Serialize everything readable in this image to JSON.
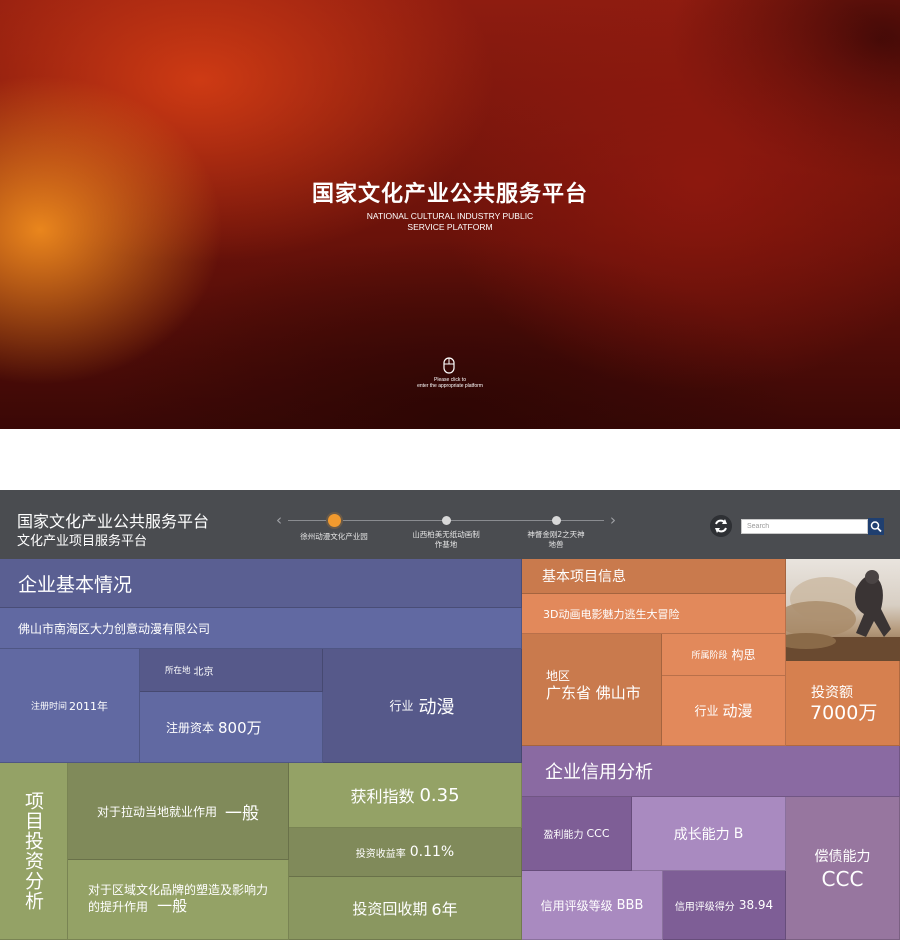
{
  "hero": {
    "title": "国家文化产业公共服务平台",
    "subtitle_line1": "NATIONAL CULTURAL INDUSTRY PUBLIC",
    "subtitle_line2": "SERVICE PLATFORM",
    "hint_line1": "Please click to",
    "hint_line2": "enter the appropriate platform",
    "mouse_icon": "mouse-icon"
  },
  "header": {
    "title": "国家文化产业公共服务平台",
    "subtitle": "文化产业项目服务平台",
    "timeline": [
      {
        "label": "徐州动漫文化产业园",
        "active": true
      },
      {
        "label_line1": "山西柏美无纸动画制",
        "label_line2": "作基地",
        "active": false
      },
      {
        "label_line1": "神督金刚2之天神",
        "label_line2": "地兽",
        "active": false
      }
    ],
    "search": {
      "placeholder": "Search"
    },
    "icons": {
      "refresh": "refresh-icon",
      "search": "search-icon",
      "prev": "chevron-left-icon",
      "next": "chevron-right-icon"
    }
  },
  "company": {
    "heading": "企业基本情况",
    "name": "佛山市南海区大力创意动漫有限公司",
    "reg_time_label": "注册时间",
    "reg_time_value": "2011年",
    "location_label": "所在地",
    "location_value": "北京",
    "capital_label": "注册资本",
    "capital_value": "800万",
    "industry_label": "行业",
    "industry_value": "动漫"
  },
  "project_info": {
    "heading": "基本项目信息",
    "project_name": "3D动画电影魅力逃生大冒险",
    "region_label": "地区",
    "region_value": "广东省 佛山市",
    "stage_label": "所属阶段",
    "stage_value": "构思",
    "industry_label": "行业",
    "industry_value": "动漫",
    "investment_label": "投资额",
    "investment_value": "7000万"
  },
  "investment": {
    "heading": "项目投资分析",
    "employment_label": "对于拉动当地就业作用",
    "employment_value": "一般",
    "brand_label_line1": "对于区域文化品牌的塑造及影响力",
    "brand_label_line2": "的提升作用",
    "brand_value": "一般",
    "profit_index_label": "获利指数",
    "profit_index_value": "0.35",
    "roi_label": "投资收益率",
    "roi_value": "0.11%",
    "payback_label": "投资回收期",
    "payback_value": "6年"
  },
  "credit": {
    "heading": "企业信用分析",
    "profitability_label": "盈利能力",
    "profitability_value": "CCC",
    "growth_label": "成长能力",
    "growth_value": "B",
    "solvency_label": "偿债能力",
    "solvency_value": "CCC",
    "rating_label": "信用评级等级",
    "rating_value": "BBB",
    "score_label": "信用评级得分",
    "score_value": "38.94"
  },
  "colors": {
    "header_bg": "#4a4c50",
    "accent_dot": "#f29a2e",
    "blue": "#5a5f92",
    "green": "#94a266",
    "orange": "#e2895b",
    "purple": "#8a6aa2"
  }
}
